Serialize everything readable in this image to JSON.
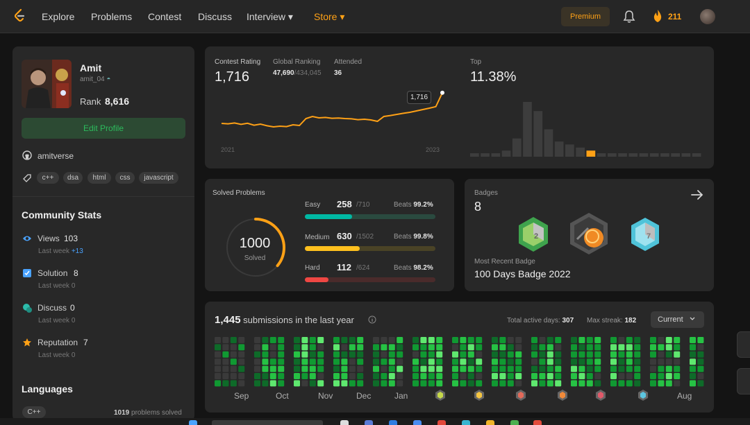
{
  "nav": {
    "items": [
      "Explore",
      "Problems",
      "Contest",
      "Discuss",
      "Interview ▾",
      "Store ▾"
    ],
    "premium": "Premium",
    "streak": "211",
    "logo_icon": "leetcode-logo",
    "bell_icon": "bell-icon",
    "fire_icon": "fire-icon"
  },
  "profile": {
    "name": "Amit",
    "handle": "amit_04",
    "rank_label": "Rank",
    "rank_value": "8,616",
    "edit_button": "Edit Profile",
    "github": "amitverse",
    "skills": [
      "c++",
      "dsa",
      "html",
      "css",
      "javascript"
    ]
  },
  "community": {
    "title": "Community Stats",
    "stats": [
      {
        "label": "Views",
        "value": "103",
        "sub_label": "Last week",
        "sub_value": "+13",
        "icon": "eye-icon",
        "color": "#4aa3ff"
      },
      {
        "label": "Solution",
        "value": "8",
        "sub_label": "Last week",
        "sub_value": "0",
        "icon": "solution-icon",
        "color": "#4aa3ff"
      },
      {
        "label": "Discuss",
        "value": "0",
        "sub_label": "Last week",
        "sub_value": "0",
        "icon": "discuss-icon",
        "color": "#2cbbaa"
      },
      {
        "label": "Reputation",
        "value": "7",
        "sub_label": "Last week",
        "sub_value": "0",
        "icon": "star-icon",
        "color": "#ffa116"
      }
    ]
  },
  "languages": {
    "title": "Languages",
    "items": [
      {
        "name": "C++",
        "count": "1019",
        "suffix": "problems solved"
      }
    ]
  },
  "contest": {
    "rating_label": "Contest Rating",
    "rating": "1,716",
    "global_label": "Global Ranking",
    "global_rank": "47,690",
    "global_total": "/434,045",
    "attended_label": "Attended",
    "attended": "36",
    "tooltip": "1,716",
    "year_start": "2021",
    "year_end": "2023",
    "top_label": "Top",
    "top_value": "11.38%"
  },
  "chart_data": [
    {
      "type": "line",
      "title": "Contest Rating",
      "x": [
        "2021",
        "2023"
      ],
      "xlabel": "",
      "ylabel": "",
      "series": [
        {
          "values": [
            1495,
            1492,
            1498,
            1488,
            1496,
            1482,
            1490,
            1478,
            1470,
            1475,
            1472,
            1485,
            1480,
            1530,
            1545,
            1535,
            1538,
            1532,
            1534,
            1530,
            1528,
            1522,
            1525,
            1520,
            1510,
            1545,
            1552,
            1560,
            1568,
            1575,
            1585,
            1595,
            1605,
            1616,
            1716
          ]
        }
      ],
      "color": "#ffa116",
      "grid": false
    },
    {
      "type": "bar",
      "title": "Top 11.38%",
      "values": [
        1,
        1,
        1,
        2,
        6,
        18,
        15,
        9,
        5,
        4,
        3,
        2,
        1,
        1,
        1,
        1,
        1,
        1,
        1,
        1,
        1,
        1
      ],
      "highlight_index": 11,
      "color": "#3d3d3d",
      "highlight_color": "#ffa116",
      "grid": false
    },
    {
      "type": "heatmap",
      "title": "submissions in the last year",
      "months": [
        "Sep",
        "Oct",
        "Nov",
        "Dec",
        "Jan",
        "Aug"
      ],
      "colors": [
        "#3a3a3a",
        "#0e6b29",
        "#109932",
        "#26c244",
        "#5fe86f"
      ]
    }
  ],
  "solved": {
    "title": "Solved Problems",
    "total": "1000",
    "total_label": "Solved",
    "fraction": 0.36,
    "difficulties": [
      {
        "name": "Easy",
        "count": "258",
        "total": "/710",
        "beats_label": "Beats",
        "beats": "99.2%",
        "fill": 0.363,
        "color": "#00b8a3",
        "track": "#2a4a3f"
      },
      {
        "name": "Medium",
        "count": "630",
        "total": "/1502",
        "beats_label": "Beats",
        "beats": "99.8%",
        "fill": 0.419,
        "color": "#ffc01e",
        "track": "#4a4326"
      },
      {
        "name": "Hard",
        "count": "112",
        "total": "/624",
        "beats_label": "Beats",
        "beats": "98.2%",
        "fill": 0.179,
        "color": "#ef4743",
        "track": "#4a2b2b"
      }
    ]
  },
  "badges": {
    "title": "Badges",
    "count": "8",
    "recent_label": "Most Recent Badge",
    "recent_name": "100 Days Badge 2022",
    "icons": [
      "green-badge-icon",
      "orange-badge-icon",
      "blue-badge-icon"
    ]
  },
  "submissions": {
    "count": "1,445",
    "label": "submissions in the last year",
    "active_label": "Total active days:",
    "active_days": "307",
    "streak_label": "Max streak:",
    "max_streak": "182",
    "select_value": "Current"
  }
}
